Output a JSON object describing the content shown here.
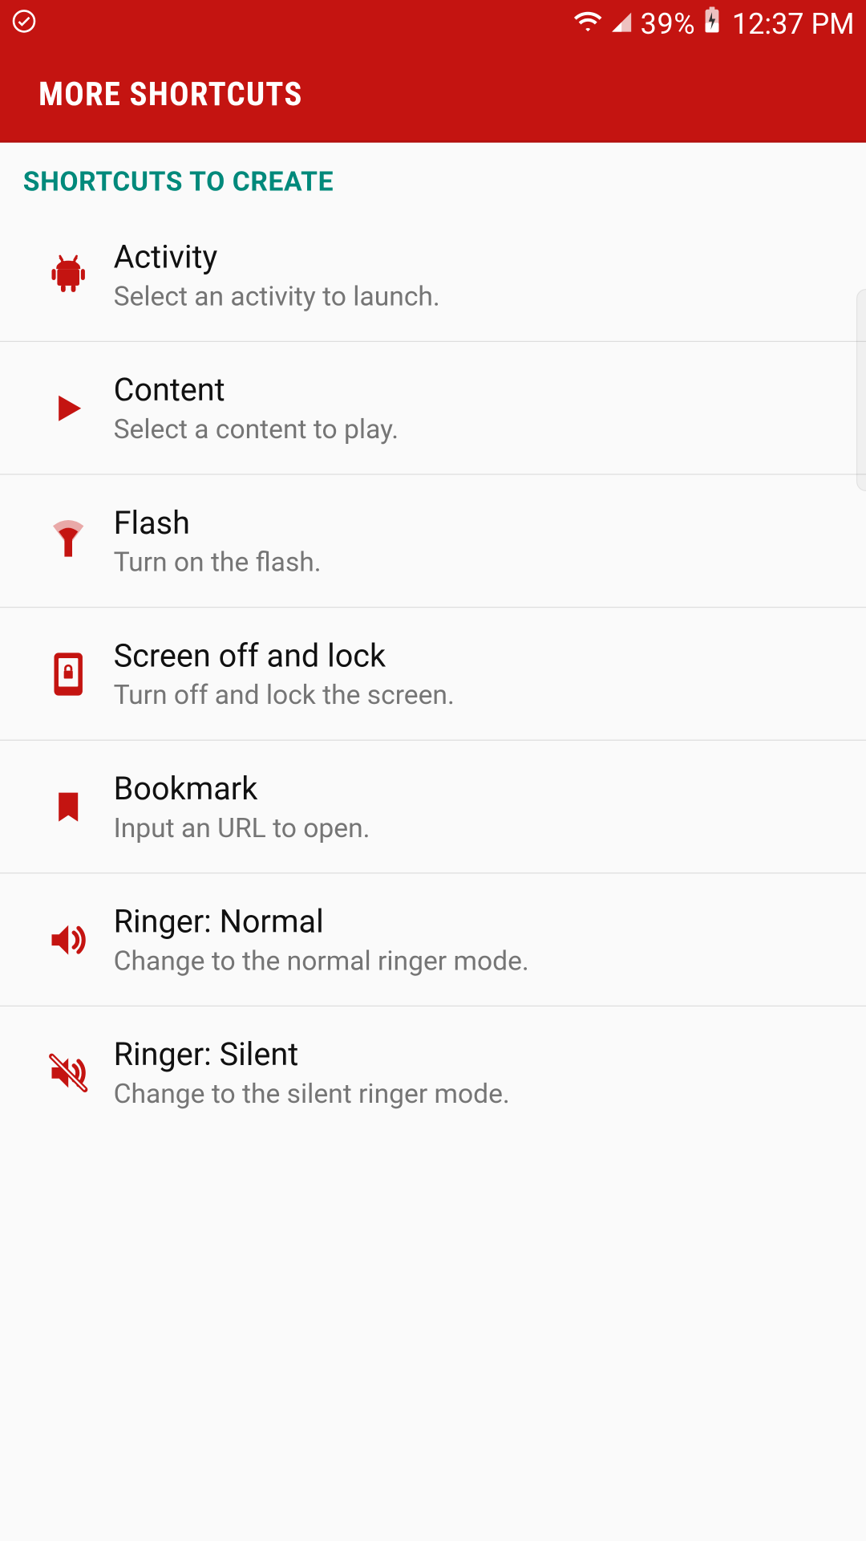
{
  "status": {
    "battery_pct": "39%",
    "time": "12:37 PM"
  },
  "app_bar": {
    "title": "MORE SHORTCUTS"
  },
  "section": {
    "header": "SHORTCUTS TO CREATE"
  },
  "items": [
    {
      "icon": "android",
      "title": "Activity",
      "subtitle": "Select an activity to launch."
    },
    {
      "icon": "play",
      "title": "Content",
      "subtitle": "Select a content to play."
    },
    {
      "icon": "flashlight",
      "title": "Flash",
      "subtitle": "Turn on the flash."
    },
    {
      "icon": "phone-lock",
      "title": "Screen off and lock",
      "subtitle": "Turn off and lock the screen."
    },
    {
      "icon": "bookmark",
      "title": "Bookmark",
      "subtitle": "Input an URL to open."
    },
    {
      "icon": "volume",
      "title": "Ringer: Normal",
      "subtitle": "Change to the normal ringer mode."
    },
    {
      "icon": "volume-off",
      "title": "Ringer: Silent",
      "subtitle": "Change to the silent ringer mode."
    }
  ],
  "colors": {
    "primary": "#c41411",
    "accent": "#00897b",
    "icon": "#c41411"
  }
}
